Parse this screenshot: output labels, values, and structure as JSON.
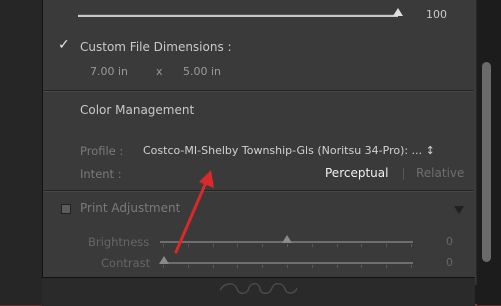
{
  "top_slider": {
    "value": "100",
    "level": 1.0
  },
  "custom_dims": {
    "label": "Custom File Dimensions :",
    "checked": true,
    "width": "7.00 in",
    "separator": "x",
    "height": "5.00 in"
  },
  "color_management": {
    "title": "Color Management",
    "profile_label": "Profile :",
    "profile_value": "Costco-MI-Shelby Township-Gls (Noritsu 34-Pro): ... ↕",
    "intent_label": "Intent :",
    "intent_options": [
      "Perceptual",
      "Relative"
    ],
    "intent_selected": "Perceptual"
  },
  "print_adjustment": {
    "label": "Print Adjustment",
    "checked": false,
    "brightness_label": "Brightness",
    "brightness_value": "0",
    "brightness_level": 0.5,
    "contrast_label": "Contrast",
    "contrast_value": "0",
    "contrast_level": 0.0
  },
  "annotation": {
    "arrow_color": "#d92a2a"
  },
  "colors": {
    "panel_bg": "#3a3a3a",
    "text": "#c9c9c9",
    "dim_text": "#7a7a7a",
    "selected_text": "#f0f0f0"
  }
}
